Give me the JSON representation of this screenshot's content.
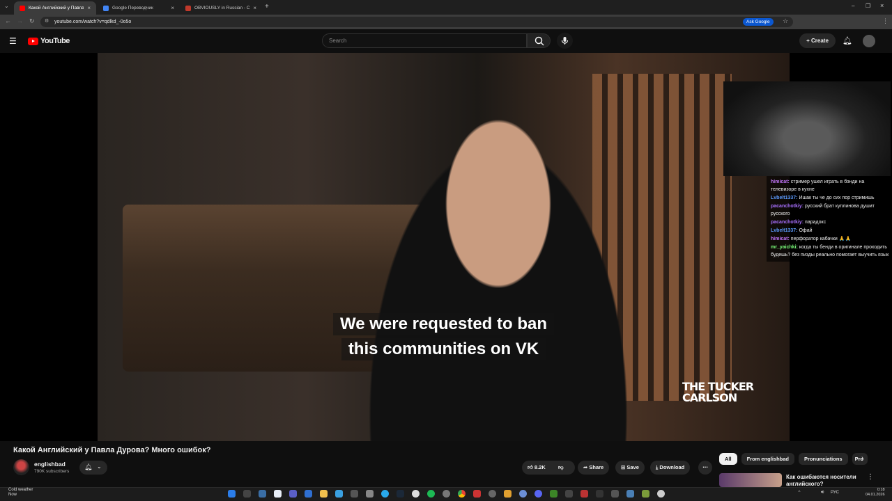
{
  "browser": {
    "tabs": [
      {
        "label": "Какой Английский у Павла Д...",
        "active": true
      },
      {
        "label": "Google Переводчик",
        "active": false
      },
      {
        "label": "OBVIOUSLY in Russian - Camb...",
        "active": false
      }
    ],
    "url": "youtube.com/watch?v=qdlkd_-0o5o",
    "ask_google": "Ask Google"
  },
  "youtube": {
    "logo": "YouTube",
    "search_placeholder": "Search",
    "create_label": "Create"
  },
  "video": {
    "subtitle_line1": "We were requested to ban",
    "subtitle_line2": "this communities on VK",
    "watermark": "THE TUCKER CARLSON"
  },
  "chat": [
    {
      "user": "himicat:",
      "text": "стример ушел играть в бэнди на телевизоре в кухне",
      "style": "u1"
    },
    {
      "user": "Lvbelt1337:",
      "text": "Ишак ты че до сих пор стримишь",
      "style": "u2"
    },
    {
      "user": "pacanchotkiy:",
      "text": "русский брат куплинова душит русского",
      "style": "u3"
    },
    {
      "user": "pacanchotkiy:",
      "text": "парадокс",
      "style": "u3"
    },
    {
      "user": "Lvbelt1337:",
      "text": "Офай",
      "style": "u2"
    },
    {
      "user": "himicat:",
      "text": "перфоратор кабачки 🙏🙏",
      "style": "u1"
    },
    {
      "user": "mr_yaichki:",
      "text": "когда ты бенди в оригинале проходить будешь? без пизды реально помогает выучить язык",
      "style": "u4"
    }
  ],
  "meta": {
    "title": "Какой Английский у Павла Дурова? Много ошибок?",
    "channel": "englishbad",
    "subscribers": "790K subscribers",
    "likes": "8.2K",
    "share": "Share",
    "save": "Save",
    "download": "Download"
  },
  "chips": [
    "All",
    "From englishbad",
    "Pronunciations",
    "Pro"
  ],
  "recommendation": {
    "title": "Как ошибаются носители английского?"
  },
  "taskbar": {
    "weather_line1": "Cold weather",
    "weather_line2": "Now",
    "lang": "РУС",
    "time": "0:18",
    "date": "04.01.2026"
  }
}
